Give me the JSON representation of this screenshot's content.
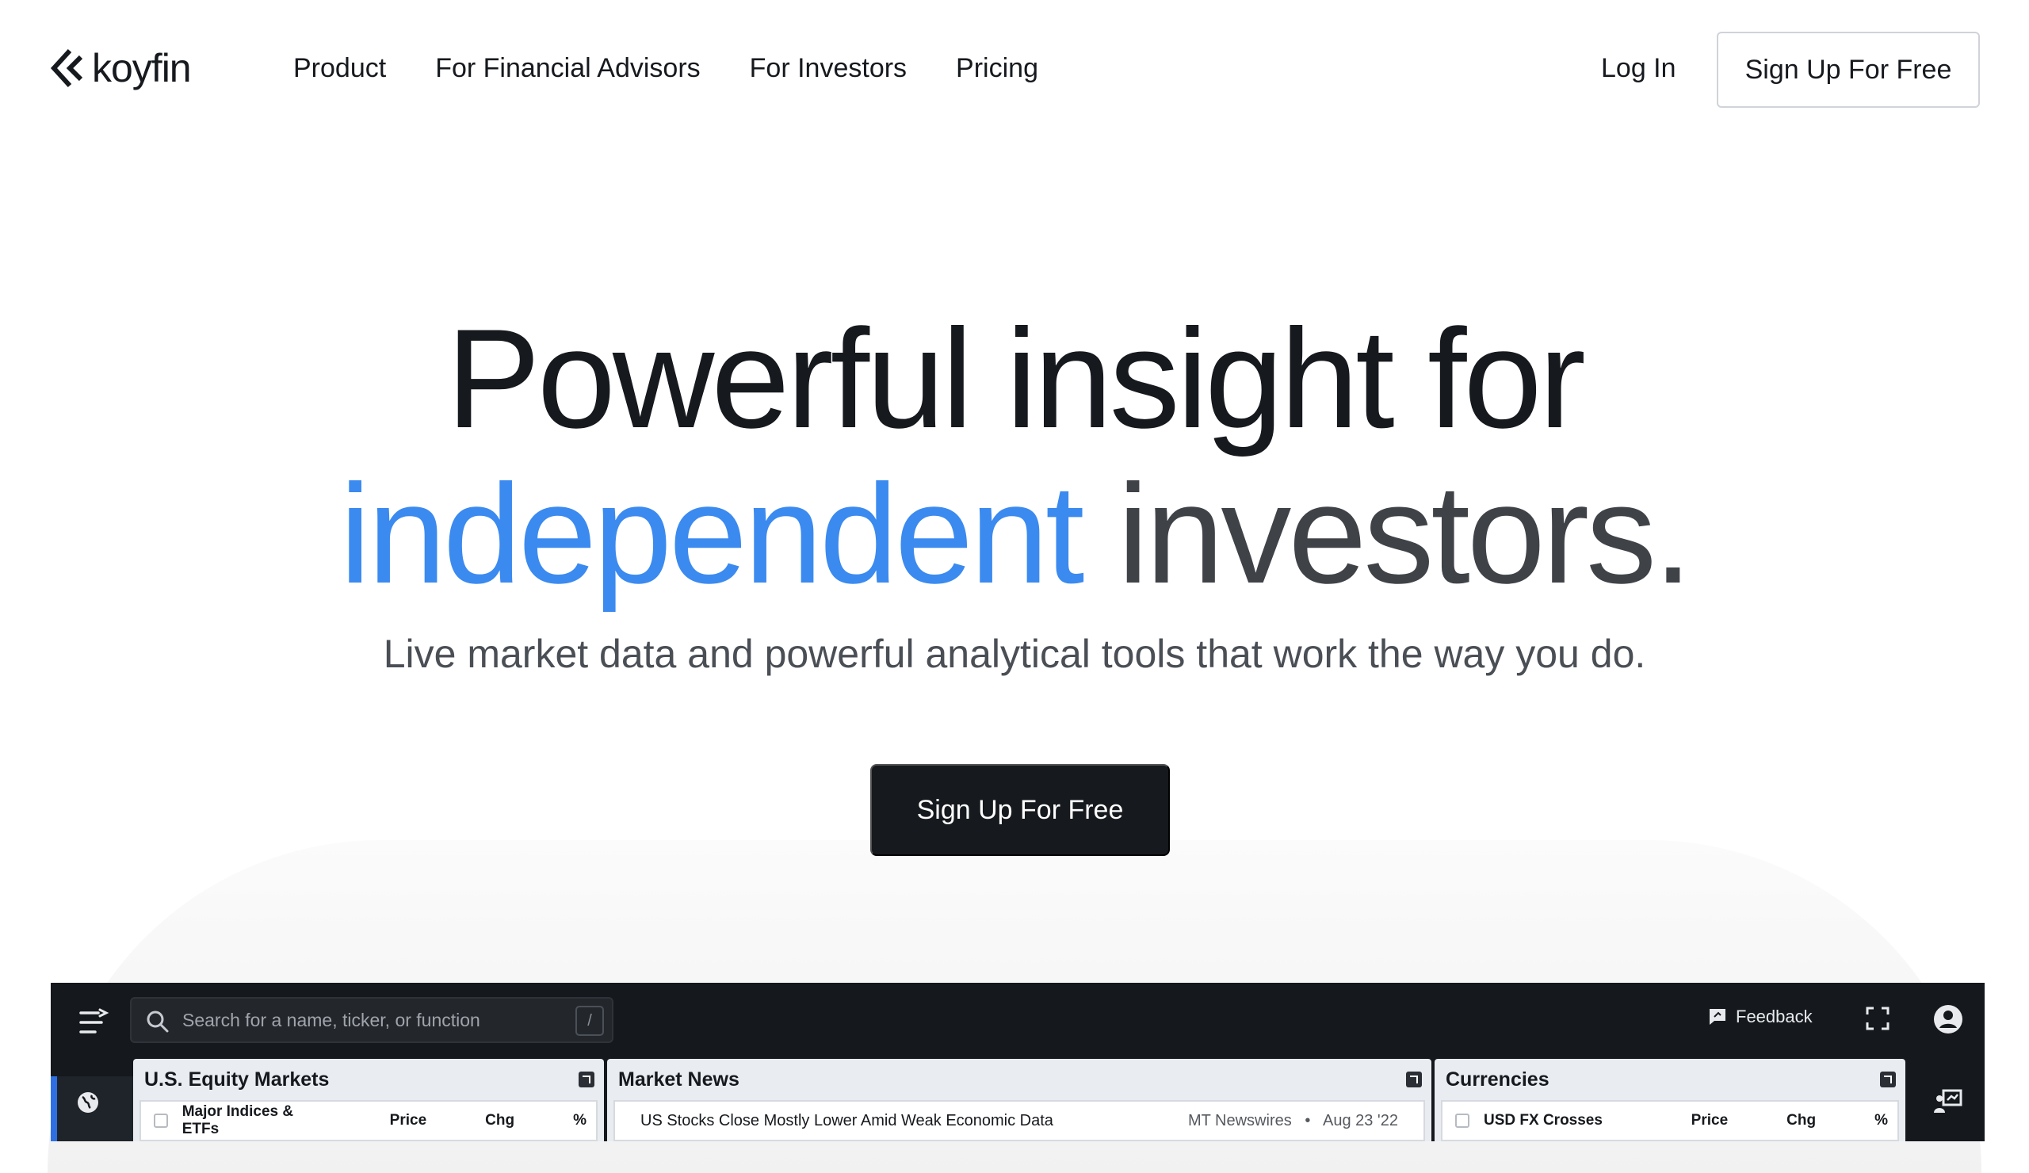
{
  "brand": {
    "name": "koyfin"
  },
  "nav": {
    "items": [
      "Product",
      "For Financial Advisors",
      "For Investors",
      "Pricing"
    ],
    "login": "Log In",
    "signup": "Sign Up For Free"
  },
  "hero": {
    "line1": "Powerful insight for",
    "highlight": "independent",
    "line2_rest": "investors.",
    "subtitle": "Live market data and powerful analytical tools that work the way you do.",
    "cta": "Sign Up For Free"
  },
  "app": {
    "search_placeholder": "Search for a name, ticker, or function",
    "search_shortcut": "/",
    "feedback": "Feedback",
    "panels": [
      {
        "title": "U.S. Equity Markets",
        "row_label": "Major Indices & ETFs",
        "cols": [
          "Price",
          "Chg",
          "%"
        ]
      },
      {
        "title": "Market News",
        "headline": "US Stocks Close Mostly Lower Amid Weak Economic Data",
        "source": "MT Newswires",
        "date": "Aug 23 '22"
      },
      {
        "title": "Currencies",
        "row_label": "USD FX Crosses",
        "cols": [
          "Price",
          "Chg",
          "%"
        ]
      }
    ]
  },
  "colors": {
    "accent": "#3b8af0",
    "dark": "#16191d",
    "app_bg": "#15181c"
  },
  "icons": [
    "koyfin-logo-icon",
    "menu-icon",
    "search-icon",
    "feedback-icon",
    "fullscreen-icon",
    "user-icon",
    "globe-icon",
    "presentation-icon",
    "external-link-icon"
  ]
}
